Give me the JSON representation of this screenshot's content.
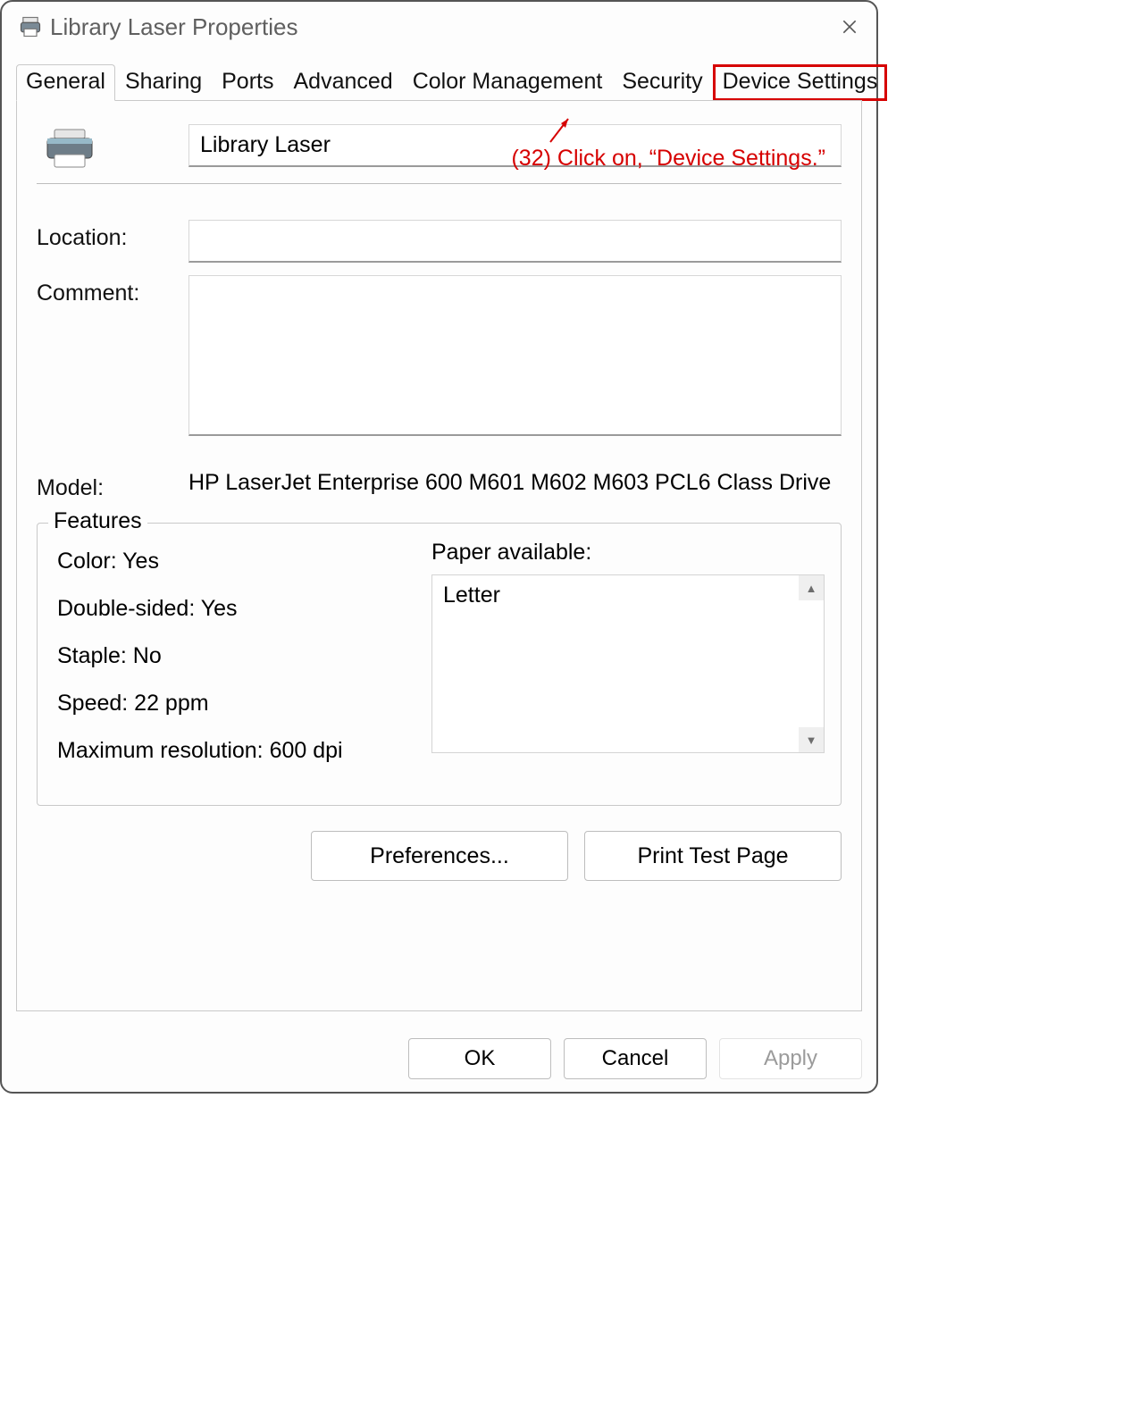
{
  "window": {
    "title": "Library Laser Properties"
  },
  "tabs": {
    "items": [
      {
        "label": "General",
        "active": true
      },
      {
        "label": "Sharing"
      },
      {
        "label": "Ports"
      },
      {
        "label": "Advanced"
      },
      {
        "label": "Color Management"
      },
      {
        "label": "Security"
      },
      {
        "label": "Device Settings",
        "highlight": true
      }
    ]
  },
  "annotation": {
    "text": "(32) Click on, “Device Settings.”"
  },
  "general": {
    "printer_name": "Library Laser",
    "location_label": "Location:",
    "location_value": "",
    "comment_label": "Comment:",
    "comment_value": "",
    "model_label": "Model:",
    "model_value": "HP LaserJet Enterprise 600 M601 M602 M603 PCL6 Class Drive"
  },
  "features": {
    "legend": "Features",
    "color": "Color: Yes",
    "double_sided": "Double-sided: Yes",
    "staple": "Staple: No",
    "speed": "Speed: 22 ppm",
    "max_res": "Maximum resolution: 600 dpi",
    "paper_label": "Paper available:",
    "paper_items": [
      "Letter"
    ]
  },
  "actions": {
    "preferences": "Preferences...",
    "print_test": "Print Test Page"
  },
  "footer": {
    "ok": "OK",
    "cancel": "Cancel",
    "apply": "Apply"
  }
}
